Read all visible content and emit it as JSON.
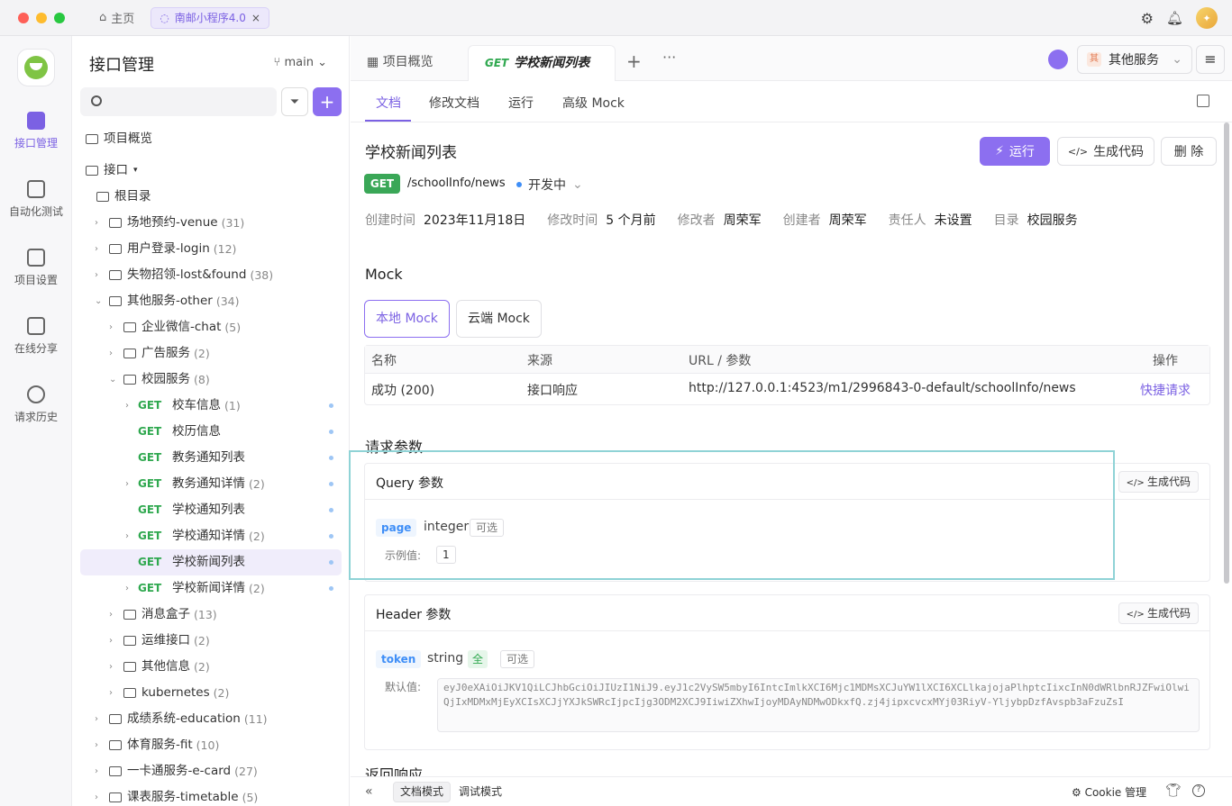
{
  "titlebar": {
    "home_label": "主页",
    "project_tab": "南邮小程序4.0",
    "close_glyph": "×",
    "avatar_glyph": "✦"
  },
  "rail": {
    "items": [
      {
        "label": "接口管理",
        "active": true
      },
      {
        "label": "自动化测试"
      },
      {
        "label": "项目设置"
      },
      {
        "label": "在线分享"
      },
      {
        "label": "请求历史"
      }
    ]
  },
  "tree": {
    "title": "接口管理",
    "branch": "main",
    "overview": "项目概览",
    "api_root": "接口",
    "root_dir": "根目录",
    "method": "GET",
    "nodes": [
      {
        "label": "场地预约-venue",
        "count": "(31)"
      },
      {
        "label": "用户登录-login",
        "count": "(12)"
      },
      {
        "label": "失物招领-lost&found",
        "count": "(38)"
      },
      {
        "label": "其他服务-other",
        "count": "(34)"
      },
      {
        "label": "企业微信-chat",
        "count": "(5)"
      },
      {
        "label": "广告服务",
        "count": "(2)"
      },
      {
        "label": "校园服务",
        "count": "(8)"
      },
      {
        "label": "校车信息",
        "count": "(1)"
      },
      {
        "label": "校历信息",
        "count": ""
      },
      {
        "label": "教务通知列表",
        "count": ""
      },
      {
        "label": "教务通知详情",
        "count": "(2)"
      },
      {
        "label": "学校通知列表",
        "count": ""
      },
      {
        "label": "学校通知详情",
        "count": "(2)"
      },
      {
        "label": "学校新闻列表",
        "count": ""
      },
      {
        "label": "学校新闻详情",
        "count": "(2)"
      },
      {
        "label": "消息盒子",
        "count": "(13)"
      },
      {
        "label": "运维接口",
        "count": "(2)"
      },
      {
        "label": "其他信息",
        "count": "(2)"
      },
      {
        "label": "kubernetes",
        "count": "(2)"
      },
      {
        "label": "成绩系统-education",
        "count": "(11)"
      },
      {
        "label": "体育服务-fit",
        "count": "(10)"
      },
      {
        "label": "一卡通服务-e-card",
        "count": "(27)"
      },
      {
        "label": "课表服务-timetable",
        "count": "(5)"
      }
    ]
  },
  "tabs": {
    "overview": "项目概览",
    "active_method": "GET",
    "active_title": "学校新闻列表",
    "plus": "+",
    "more": "···",
    "service": "其他服务",
    "service_badge": "其",
    "menu": "≡"
  },
  "subtabs": [
    "文档",
    "修改文档",
    "运行",
    "高级 Mock"
  ],
  "doc": {
    "title": "学校新闻列表",
    "run": "运行",
    "gen_code": "生成代码",
    "delete": "删 除",
    "method": "GET",
    "path": "/schoolInfo/news",
    "status": "开发中",
    "meta": [
      {
        "k": "创建时间",
        "v": "2023年11月18日"
      },
      {
        "k": "修改时间",
        "v": "5 个月前"
      },
      {
        "k": "修改者",
        "v": "周荣军"
      },
      {
        "k": "创建者",
        "v": "周荣军"
      },
      {
        "k": "责任人",
        "v": "未设置"
      },
      {
        "k": "目录",
        "v": "校园服务"
      }
    ]
  },
  "mock": {
    "section": "Mock",
    "local": "本地 Mock",
    "cloud": "云端 Mock",
    "headers": [
      "名称",
      "来源",
      "URL / 参数",
      "操作"
    ],
    "row": {
      "name": "成功 (200)",
      "source": "接口响应",
      "url": "http://127.0.0.1:4523/m1/2996843-0-default/schoolInfo/news",
      "action": "快捷请求"
    }
  },
  "params": {
    "section": "请求参数",
    "gen_code": "生成代码",
    "query": {
      "title": "Query 参数",
      "name": "page",
      "type": "integer",
      "optional": "可选",
      "example_label": "示例值:",
      "example": "1"
    },
    "header": {
      "title": "Header 参数",
      "name": "token",
      "type": "string",
      "all": "全",
      "optional": "可选",
      "default_label": "默认值:",
      "default": "eyJ0eXAiOiJKV1QiLCJhbGciOiJIUzI1NiJ9.eyJ1c2VySW5mbyI6IntcImlkXCI6Mjc1MDMsXCJuYW1lXCI6XCLlkajojaPlhptcIixcInN0dWRlbnRJZFwiOlwiQjIxMDMxMjEyXCIsXCJjYXJkSWRcIjpcIjg3ODM2XCJ9IiwiZXhwIjoyMDAyNDMwODkxfQ.zj4jipxcvcxMYj03RiyV-YljybpDzfAvspb3aFzuZsI"
    },
    "response": "返回响应"
  },
  "footer": {
    "collapse": "«",
    "doc_mode": "文档模式",
    "debug_mode": "调试模式",
    "cookie": "Cookie 管理",
    "help": "?"
  }
}
